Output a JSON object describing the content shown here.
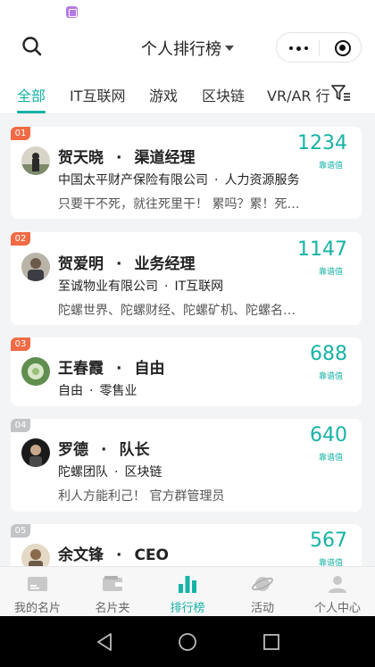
{
  "header": {
    "title": "个人排行榜"
  },
  "tabs": [
    {
      "label": "全部",
      "active": true
    },
    {
      "label": "IT互联网"
    },
    {
      "label": "游戏"
    },
    {
      "label": "区块链"
    },
    {
      "label": "VR/AR 行"
    }
  ],
  "score_label": "靠谱值",
  "ranking": [
    {
      "rank": "01",
      "name": "贺天晓",
      "title": "渠道经理",
      "company": "中国太平财产保险有限公司",
      "industry": "人力资源服务",
      "bio": "只要干不死，就往死里干！ 累吗？累！死…",
      "score": "1234"
    },
    {
      "rank": "02",
      "name": "贺爱明",
      "title": "业务经理",
      "company": "至诚物业有限公司",
      "industry": "IT互联网",
      "bio": "陀螺世界、陀螺财经、陀螺矿机、陀螺名…",
      "score": "1147"
    },
    {
      "rank": "03",
      "name": "王春霞",
      "title": "自由",
      "company": "自由",
      "industry": "零售业",
      "bio": "",
      "score": "688"
    },
    {
      "rank": "04",
      "name": "罗德",
      "title": "队长",
      "company": "陀螺团队",
      "industry": "区块链",
      "bio": "利人方能利己！ 官方群管理员",
      "score": "640"
    },
    {
      "rank": "05",
      "name": "余文锋",
      "title": "CEO",
      "company": "",
      "industry": "",
      "bio": "",
      "score": "567"
    }
  ],
  "tabbar": [
    {
      "label": "我的名片",
      "icon": "card-icon"
    },
    {
      "label": "名片夹",
      "icon": "wallet-icon"
    },
    {
      "label": "排行榜",
      "icon": "ranking-icon",
      "active": true
    },
    {
      "label": "活动",
      "icon": "planet-icon"
    },
    {
      "label": "个人中心",
      "icon": "person-icon"
    }
  ],
  "colors": {
    "accent": "#16b3a5",
    "rank_hot": "#f06b45",
    "rank_normal": "#c2c4c8"
  }
}
